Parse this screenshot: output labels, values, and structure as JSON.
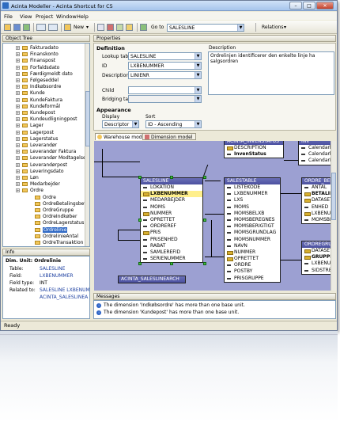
{
  "window": {
    "title": "Acinta Modeller - Acinta Shortcut for C5"
  },
  "menu": [
    "File",
    "View",
    "Project",
    "Window",
    "Help"
  ],
  "toolbar": {
    "new_label": "New",
    "goto_label": "Go to",
    "goto_value": "SALESLINE",
    "relations_label": "Relations"
  },
  "object_tree": {
    "title": "Object Tree",
    "items": [
      "Fakturadato",
      "Finanskonto",
      "Finanspost",
      "Forfaldsdato",
      "Færdigmeldt dato",
      "Følgeseddel",
      "Indkøbsordre",
      "Kunde",
      "KundeFaktura",
      "Kundeformål",
      "Kundepost",
      "Kundeudligningpost",
      "Lager",
      "Lagerpost",
      "Lagerstatus",
      "Leverandør",
      "Leverandør Faktura",
      "Leverandør Modtagelse",
      "Leverandørpost",
      "Leveringsdato",
      "Løn",
      "Medarbejder",
      "Ordre"
    ],
    "sub_items": [
      "Ordre",
      "OrdreBetalingsbeting",
      "OrdreGruppe",
      "OrdreIndkøber",
      "OrdreLagerstatus",
      "Ordrelinie",
      "OrdrelinieAntal",
      "OrdreTransaktion"
    ],
    "selected": "Ordrelinie"
  },
  "info": {
    "title": "Info",
    "dim_unit_label": "Dim. Unit:",
    "dim_unit_value": "Ordrelinie",
    "table_label": "Table:",
    "table_value": "SALESLINE",
    "field_label": "Field:",
    "field_value": "LXBENUMMER",
    "field_type_label": "Field type:",
    "field_type_value": "INT",
    "related_label": "Related to:",
    "related": [
      "SALESLINE LXBENUM",
      "ACINTA_SALESLINEA"
    ]
  },
  "properties": {
    "title": "Properties",
    "definition_label": "Definition",
    "description_label": "Description",
    "lookup_label": "Lookup table",
    "lookup_value": "SALESLINE",
    "id_label": "ID",
    "id_value": "LXBENUMMER",
    "desc_label": "Description",
    "desc_value": "LINIENR",
    "description_text": "Ordrelinjen identificerer den enkelte linje ha salgsordren",
    "child_label": "Child",
    "bridging_label": "Bridging table",
    "appearance_label": "Appearance",
    "display_label": "Display",
    "display_value": "Descriptor",
    "sort_label": "Sort",
    "sort_value": "ID - Ascending"
  },
  "tabs": [
    "Warehouse model",
    "Dimension model"
  ],
  "model": {
    "tables": [
      {
        "name": "SALESLINE",
        "rows": [
          "LOKATION",
          "LXBENUMMER",
          "MEDARBEJDER",
          "MOMS",
          "NUMMER",
          "OPRETTET",
          "ORDREREF",
          "PRIS",
          "PRISENHED",
          "RABAT",
          "SAMLEREFID",
          "SERIENUMMER"
        ]
      },
      {
        "name": "SALESTABLE",
        "rows": [
          "LISTEKODE",
          "LXBENUMMER",
          "LXS",
          "MOMS",
          "MOMSBELXB",
          "MOMSBEREGNES",
          "MOMSBERIGTIGT",
          "MOMSGRUNDLAG",
          "MOMSNUMMER",
          "NAVN",
          "NUMMER",
          "OPRETTET",
          "ORDRE",
          "POSTBY",
          "PRISGRUPPE"
        ]
      },
      {
        "name": "ACINTA_INVENSTATUS",
        "rows": [
          "DESCRIPTION",
          "InvenStatus"
        ]
      },
      {
        "name": "ORDRE_BEREGN",
        "rows": [
          "ANTAL",
          "BETALIN",
          "DATASET",
          "ENHED",
          "LXBENUM",
          "MOMSBEL"
        ]
      },
      {
        "name": "ORDREGRUPPE",
        "rows": [
          "DATASET",
          "GRUPPE",
          "LXBENUM",
          "SIDSTRE"
        ]
      },
      {
        "name": "INV",
        "rows": [
          "Calendarh",
          "Calendarh",
          "CalendarL"
        ]
      },
      {
        "name": "ACINTA_SALESLINEARCH",
        "rows": []
      }
    ]
  },
  "messages": {
    "title": "Messages",
    "items": [
      "The dimension 'Indkøbsordre' has more than one base unit.",
      "The dimension 'Kundepost' has more than one base unit."
    ]
  },
  "status": "Ready",
  "colors": {
    "accent": "#316ac5",
    "canvas": "#9ca0d2",
    "table_header": "#4b50a0"
  }
}
